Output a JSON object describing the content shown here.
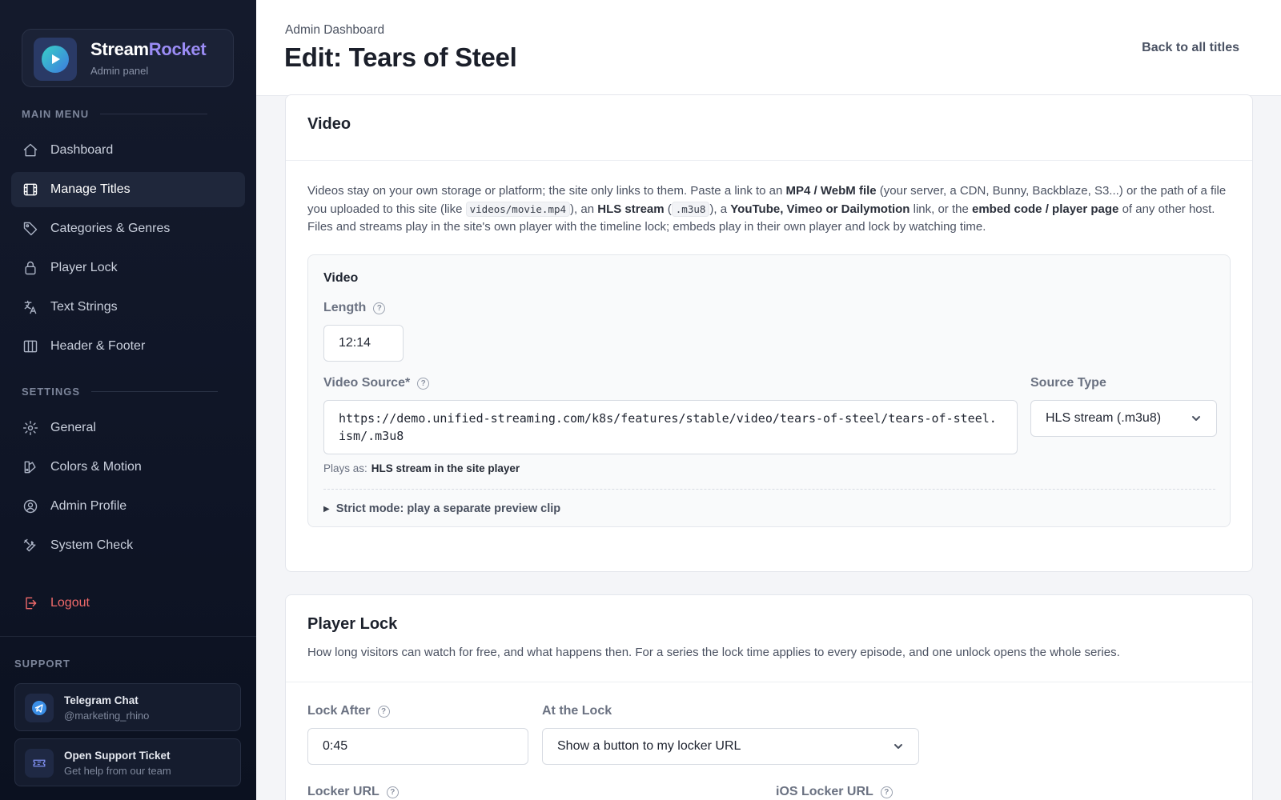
{
  "brand": {
    "name_a": "Stream",
    "name_b": "Rocket",
    "subtitle": "Admin panel"
  },
  "sidebar": {
    "main_label": "MAIN MENU",
    "main_items": [
      {
        "label": "Dashboard",
        "icon": "home-icon"
      },
      {
        "label": "Manage Titles",
        "icon": "film-icon",
        "active": true
      },
      {
        "label": "Categories & Genres",
        "icon": "tag-icon"
      },
      {
        "label": "Player Lock",
        "icon": "lock-icon"
      },
      {
        "label": "Text Strings",
        "icon": "translate-icon"
      },
      {
        "label": "Header & Footer",
        "icon": "columns-icon"
      }
    ],
    "settings_label": "SETTINGS",
    "settings_items": [
      {
        "label": "General",
        "icon": "gear-icon"
      },
      {
        "label": "Colors & Motion",
        "icon": "palette-icon"
      },
      {
        "label": "Admin Profile",
        "icon": "user-circle-icon"
      },
      {
        "label": "System Check",
        "icon": "tools-icon"
      }
    ],
    "logout_label": "Logout",
    "support_label": "SUPPORT",
    "support": [
      {
        "title": "Telegram Chat",
        "sub": "@marketing_rhino",
        "icon": "telegram-icon"
      },
      {
        "title": "Open Support Ticket",
        "sub": "Get help from our team",
        "icon": "ticket-icon"
      }
    ]
  },
  "header": {
    "breadcrumb": "Admin Dashboard",
    "title": "Edit: Tears of Steel",
    "back_link": "Back to all titles"
  },
  "video_card": {
    "title": "Video",
    "desc": {
      "p1": "Videos stay on your own storage or platform; the site only links to them. Paste a link to an ",
      "b1": "MP4 / WebM file",
      "p2": " (your server, a CDN, Bunny, Backblaze, S3...) or the path of a file you uploaded to this site (like ",
      "c1": "videos/movie.mp4",
      "p3": "), an ",
      "b2": "HLS stream",
      "p4": " (",
      "c2": ".m3u8",
      "p5": "), a ",
      "b3": "YouTube, Vimeo or Dailymotion",
      "p6": " link, or the ",
      "b4": "embed code / player page",
      "p7": " of any other host. Files and streams play in the site's own player with the timeline lock; embeds play in their own player and lock by watching time."
    },
    "inner_title": "Video",
    "length_label": "Length",
    "length_value": "12:14",
    "source_label": "Video Source*",
    "source_value": "https://demo.unified-streaming.com/k8s/features/stable/video/tears-of-steel/tears-of-steel.ism/.m3u8",
    "source_type_label": "Source Type",
    "source_type_value": "HLS stream (.m3u8)",
    "plays_as_label": "Plays as:",
    "plays_as_value": "HLS stream in the site player",
    "strict_mode": "Strict mode: play a separate preview clip"
  },
  "lock_card": {
    "title": "Player Lock",
    "desc": "How long visitors can watch for free, and what happens then. For a series the lock time applies to every episode, and one unlock opens the whole series.",
    "lock_after_label": "Lock After",
    "lock_after_value": "0:45",
    "at_lock_label": "At the Lock",
    "at_lock_value": "Show a button to my locker URL",
    "locker_url_label": "Locker URL",
    "ios_locker_url_label": "iOS Locker URL"
  },
  "help_glyph": "?",
  "details_marker": "▶"
}
